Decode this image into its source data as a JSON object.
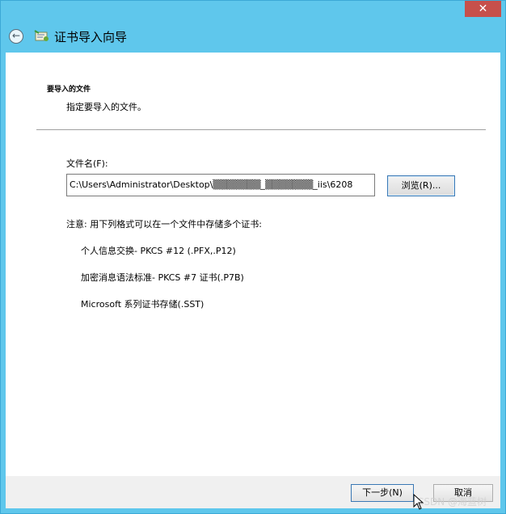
{
  "window": {
    "close_label": "✕",
    "title": "证书导入向导"
  },
  "header": {
    "label": "要导入的文件",
    "description": "指定要导入的文件。"
  },
  "form": {
    "filename_label": "文件名(F):",
    "filename_value": "C:\\Users\\Administrator\\Desktop\\▒▒▒▒▒▒▒_▒▒▒▒▒▒▒_iis\\6208",
    "browse_label": "浏览(R)..."
  },
  "note": {
    "text": "注意: 用下列格式可以在一个文件中存储多个证书:",
    "formats": [
      "个人信息交换- PKCS #12 (.PFX,.P12)",
      "加密消息语法标准- PKCS #7 证书(.P7B)",
      "Microsoft 系列证书存储(.SST)"
    ]
  },
  "footer": {
    "next_label": "下一步(N)",
    "cancel_label": "取消"
  },
  "watermark": "CSDN @海蓝树"
}
